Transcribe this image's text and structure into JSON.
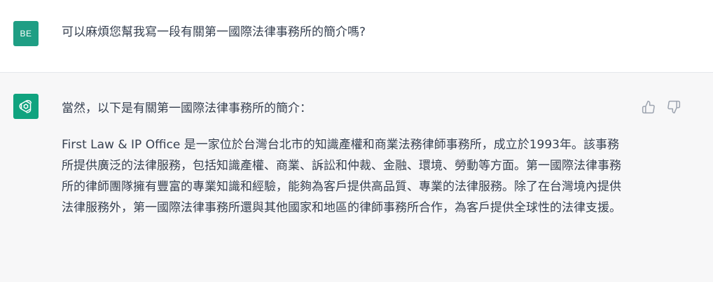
{
  "conversation": {
    "user": {
      "avatar_initials": "BE",
      "avatar_color": "#1f9e84",
      "message": "可以麻煩您幫我寫一段有關第一國際法律事務所的簡介嗎?"
    },
    "assistant": {
      "avatar_icon": "openai-logo-icon",
      "avatar_color": "#10a37f",
      "intro": "當然，以下是有關第一國際法律事務所的簡介：",
      "paragraph": "First Law & IP Office 是一家位於台灣台北市的知識產權和商業法務律師事務所，成立於1993年。該事務所提供廣泛的法律服務，包括知識產權、商業、訴訟和仲裁、金融、環境、勞動等方面。第一國際法律事務所的律師團隊擁有豐富的專業知識和經驗，能夠為客戶提供高品質、專業的法律服務。除了在台灣境內提供法律服務外，第一國際法律事務所還與其他國家和地區的律師事務所合作，為客戶提供全球性的法律支援。",
      "feedback": {
        "thumbs_up_icon": "thumbs-up-icon",
        "thumbs_down_icon": "thumbs-down-icon"
      }
    }
  }
}
